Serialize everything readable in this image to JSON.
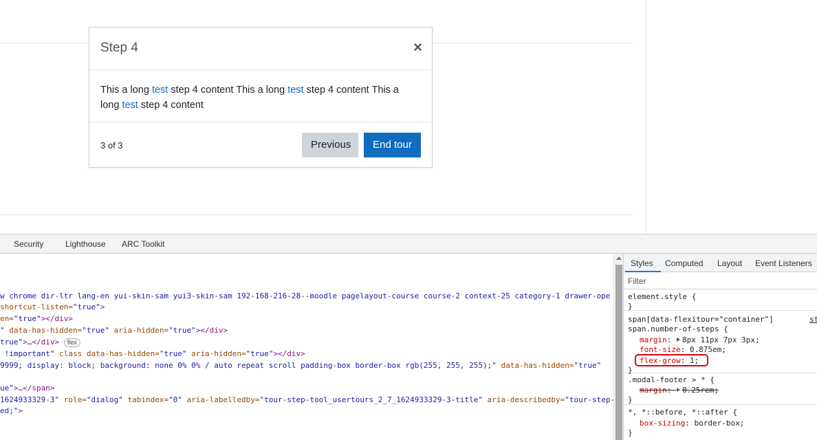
{
  "tour": {
    "title": "Step 4",
    "close_symbol": "×",
    "body": {
      "p1": "This a long ",
      "link": "test",
      "p2": " step 4 content This a long ",
      "p3": " step 4 content This a ",
      "p4": "long ",
      "p5": " step 4 content"
    },
    "counter": "3 of 3",
    "prev_label": "Previous",
    "end_label": "End tour"
  },
  "devtools": {
    "tabs": [
      "Security",
      "Lighthouse",
      "ARC Toolkit"
    ],
    "elements": {
      "l1": "w chrome dir-ltr lang-en yui-skin-sam yui3-skin-sam 192-168-216-28--moodle pagelayout-course course-2 context-25 category-1 drawer-ope",
      "l2a": "shortcut-listen=",
      "l2b": "\"true\"",
      "l2c": ">",
      "l3a": "en=",
      "l3b": "\"true\"",
      "l3c": "></div>",
      "l4a": "\" ",
      "l4b": "data-has-hidden=",
      "l4c": "\"true\"",
      "l4d": " aria-hidden=",
      "l4e": "\"true\"",
      "l4f": "></div>",
      "l5a": "true\"",
      "l5b": ">…</div>",
      "l5badge": "flex",
      "l6a": " !important\"",
      "l6b": " class data-has-hidden=",
      "l6c": "\"true\"",
      "l6d": " aria-hidden=",
      "l6e": "\"true\"",
      "l6f": "></div>",
      "l7a": "9999; display: block; background: none 0% 0% / auto repeat scroll padding-box border-box rgb(255, 255, 255);\"",
      "l7b": " data-has-hidden=",
      "l7c": "\"true\"",
      "l8a": "ue\"",
      "l8b": ">…</span>",
      "l9a": "1624933329-3\"",
      "l9b": " role=",
      "l9c": "\"dialog\"",
      "l9d": " tabindex=",
      "l9e": "\"0\"",
      "l9f": " aria-labelledby=",
      "l9g": "\"tour-step-tool_usertours_2_7_1624933329-3-title\"",
      "l9h": " aria-describedby=",
      "l9i": "\"tour-step-",
      "l10a": "ed;\"",
      "l10b": ">"
    },
    "styles_tabs": [
      "Styles",
      "Computed",
      "Layout",
      "Event Listeners"
    ],
    "filter_placeholder": "Filter",
    "rules": {
      "r1_selector": "element.style {",
      "close_brace": "}",
      "r2_sel1": "span[data-flexitour=\"container\"]",
      "r2_source": "st",
      "r2_sel2": "span.number-of-steps {",
      "margin_prop": "margin",
      "margin_val": "8px 11px 7px 3px",
      "fontsize_prop": "font-size",
      "fontsize_val": "0.875em",
      "flexgrow_prop": "flex-grow",
      "flexgrow_val": "1",
      "r3_selector": ".modal-footer > * {",
      "r3_margin_val": "0.25rem",
      "r4_selector": "*, *::before, *::after {",
      "boxsizing_prop": "box-sizing",
      "boxsizing_val": "border-box"
    }
  }
}
